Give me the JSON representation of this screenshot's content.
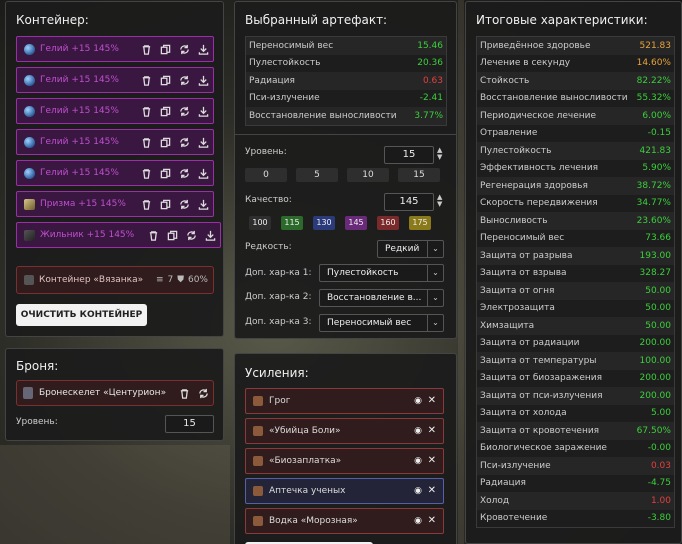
{
  "container": {
    "title": "Контейнер:",
    "slots": [
      {
        "label": "Гелий +15 145%",
        "icon": "helium-icon"
      },
      {
        "label": "Гелий +15 145%",
        "icon": "helium-icon"
      },
      {
        "label": "Гелий +15 145%",
        "icon": "helium-icon"
      },
      {
        "label": "Гелий +15 145%",
        "icon": "helium-icon"
      },
      {
        "label": "Гелий +15 145%",
        "icon": "helium-icon"
      },
      {
        "label": "Призма +15 145%",
        "icon": "prism-icon"
      },
      {
        "label": "Жильник +15 145%",
        "icon": "dark-artifact-icon"
      }
    ],
    "item": {
      "label": "Контейнер «Вязанка»",
      "slots": "7",
      "protection": "60%"
    },
    "clear_label": "ОЧИСТИТЬ КОНТЕЙНЕР"
  },
  "armor": {
    "title": "Броня:",
    "item_label": "Бронескелет «Центурион»",
    "level_label": "Уровень:",
    "level_value": "15"
  },
  "artifact": {
    "title": "Выбранный артефакт:",
    "props": [
      {
        "name": "Переносимый вес",
        "value": "15.46",
        "tone": "pos"
      },
      {
        "name": "Пулестойкость",
        "value": "20.36",
        "tone": "pos"
      },
      {
        "name": "Радиация",
        "value": "0.63",
        "tone": "neg"
      },
      {
        "name": "Пси-излучение",
        "value": "-2.41",
        "tone": "pos"
      },
      {
        "name": "Восстановление выносливости",
        "value": "3.77%",
        "tone": "pos"
      }
    ],
    "level_label": "Уровень:",
    "level_value": "15",
    "level_presets": [
      "0",
      "5",
      "10",
      "15"
    ],
    "quality_label": "Качество:",
    "quality_value": "145",
    "quality_presets": [
      {
        "label": "100",
        "color": "#2e2e2e"
      },
      {
        "label": "115",
        "color": "#2c6a2c"
      },
      {
        "label": "130",
        "color": "#2a3a7a"
      },
      {
        "label": "145",
        "color": "#6a2a7a"
      },
      {
        "label": "160",
        "color": "#7a2a2a"
      },
      {
        "label": "175",
        "color": "#8a7a1a"
      }
    ],
    "rarity_label": "Редкость:",
    "rarity_value": "Редкий",
    "extra1_label": "Доп. хар-ка 1:",
    "extra1_value": "Пулестойкость",
    "extra2_label": "Доп. хар-ка 2:",
    "extra2_value": "Восстановление в...",
    "extra3_label": "Доп. хар-ка 3:",
    "extra3_value": "Переносимый вес"
  },
  "boosts": {
    "title": "Усиления:",
    "items": [
      {
        "label": "Грог",
        "style": "red"
      },
      {
        "label": "«Убийца Боли»",
        "style": "red"
      },
      {
        "label": "«Биозаплатка»",
        "style": "red"
      },
      {
        "label": "Аптечка ученых",
        "style": "blue"
      },
      {
        "label": "Водка «Морозная»",
        "style": "red"
      }
    ]
  },
  "totals": {
    "title": "Итоговые характеристики:",
    "rows": [
      {
        "name": "Приведённое здоровье",
        "value": "521.83",
        "tone": "orange"
      },
      {
        "name": "Лечение в секунду",
        "value": "14.60%",
        "tone": "orange"
      },
      {
        "name": "Стойкость",
        "value": "82.22%",
        "tone": "pos"
      },
      {
        "name": "Восстановление выносливости",
        "value": "55.32%",
        "tone": "pos"
      },
      {
        "name": "Периодическое лечение",
        "value": "6.00%",
        "tone": "pos"
      },
      {
        "name": "Отравление",
        "value": "-0.15",
        "tone": "pos"
      },
      {
        "name": "Пулестойкость",
        "value": "421.83",
        "tone": "pos"
      },
      {
        "name": "Эффективность лечения",
        "value": "5.90%",
        "tone": "pos"
      },
      {
        "name": "Регенерация здоровья",
        "value": "38.72%",
        "tone": "pos"
      },
      {
        "name": "Скорость передвижения",
        "value": "34.77%",
        "tone": "pos"
      },
      {
        "name": "Выносливость",
        "value": "23.60%",
        "tone": "pos"
      },
      {
        "name": "Переносимый вес",
        "value": "73.66",
        "tone": "pos"
      },
      {
        "name": "Защита от разрыва",
        "value": "193.00",
        "tone": "pos"
      },
      {
        "name": "Защита от взрыва",
        "value": "328.27",
        "tone": "pos"
      },
      {
        "name": "Защита от огня",
        "value": "50.00",
        "tone": "pos"
      },
      {
        "name": "Электрозащита",
        "value": "50.00",
        "tone": "pos"
      },
      {
        "name": "Химзащита",
        "value": "50.00",
        "tone": "pos"
      },
      {
        "name": "Защита от радиации",
        "value": "200.00",
        "tone": "pos"
      },
      {
        "name": "Защита от температуры",
        "value": "100.00",
        "tone": "pos"
      },
      {
        "name": "Защита от биозаражения",
        "value": "200.00",
        "tone": "pos"
      },
      {
        "name": "Защита от пси-излучения",
        "value": "200.00",
        "tone": "pos"
      },
      {
        "name": "Защита от холода",
        "value": "5.00",
        "tone": "pos"
      },
      {
        "name": "Защита от кровотечения",
        "value": "67.50%",
        "tone": "pos"
      },
      {
        "name": "Биологическое заражение",
        "value": "-0.00",
        "tone": "pos"
      },
      {
        "name": "Пси-излучение",
        "value": "0.03",
        "tone": "neg"
      },
      {
        "name": "Радиация",
        "value": "-4.75",
        "tone": "pos"
      },
      {
        "name": "Холод",
        "value": "1.00",
        "tone": "neg"
      },
      {
        "name": "Кровотечение",
        "value": "-3.80",
        "tone": "pos"
      }
    ]
  }
}
